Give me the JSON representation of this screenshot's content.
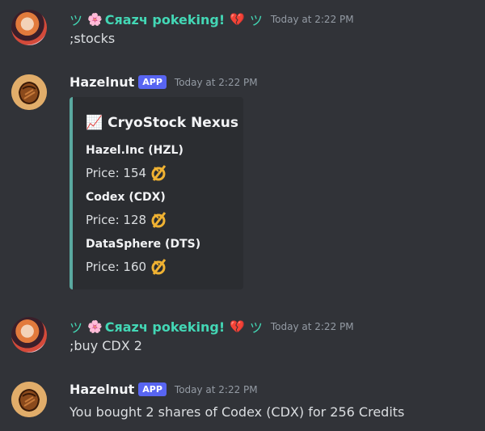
{
  "messages": [
    {
      "prefix": "ツ",
      "flower": "🌸",
      "username": "Cяazч pokeking!",
      "heart": "💔",
      "suffix": "ツ",
      "timestamp": "Today at 2:22 PM",
      "text": ";stocks"
    },
    {
      "username": "Hazelnut",
      "badge": "APP",
      "timestamp": "Today at 2:22 PM",
      "embed": {
        "title_icon": "📈",
        "title": "CryoStock Nexus",
        "stocks": [
          {
            "name": "Hazel.Inc (HZL)",
            "price": "Price: 154"
          },
          {
            "name": "Codex (CDX)",
            "price": "Price: 128"
          },
          {
            "name": "DataSphere (DTS)",
            "price": "Price: 160"
          }
        ]
      }
    },
    {
      "prefix": "ツ",
      "flower": "🌸",
      "username": "Cяazч pokeking!",
      "heart": "💔",
      "suffix": "ツ",
      "timestamp": "Today at 2:22 PM",
      "text": ";buy CDX 2"
    },
    {
      "username": "Hazelnut",
      "badge": "APP",
      "timestamp": "Today at 2:22 PM",
      "text": "You bought 2 shares of Codex (CDX) for 256 Credits"
    }
  ],
  "colors": {
    "background": "#313338",
    "user_name": "#43d7b5",
    "badge": "#5865f2",
    "embed_border": "#5aa9a0",
    "embed_bg": "#2b2d31",
    "coin": "#f0b232"
  },
  "icons": {
    "coin": "credit-coin-icon",
    "chart": "chart-increasing-icon"
  }
}
